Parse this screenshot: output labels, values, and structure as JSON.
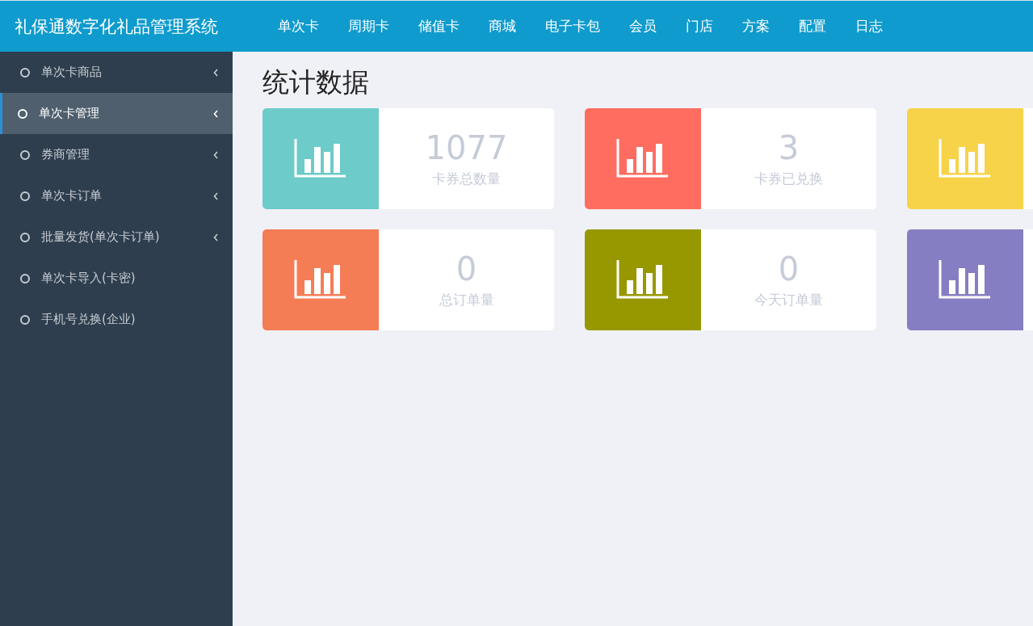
{
  "app_title": "礼保通数字化礼品管理系统",
  "nav": [
    {
      "label": "单次卡"
    },
    {
      "label": "周期卡"
    },
    {
      "label": "储值卡"
    },
    {
      "label": "商城"
    },
    {
      "label": "电子卡包"
    },
    {
      "label": "会员"
    },
    {
      "label": "门店"
    },
    {
      "label": "方案"
    },
    {
      "label": "配置"
    },
    {
      "label": "日志"
    }
  ],
  "sidebar": {
    "items": [
      {
        "label": "单次卡商品",
        "selected": false,
        "expandable": true
      },
      {
        "label": "单次卡管理",
        "selected": true,
        "expandable": true
      },
      {
        "label": "券商管理",
        "selected": false,
        "expandable": true
      },
      {
        "label": "单次卡订单",
        "selected": false,
        "expandable": true
      },
      {
        "label": "批量发货(单次卡订单)",
        "selected": false,
        "expandable": true
      },
      {
        "label": "单次卡导入(卡密)",
        "selected": false,
        "expandable": false
      },
      {
        "label": "手机号兑换(企业)",
        "selected": false,
        "expandable": false
      }
    ]
  },
  "page_title": "统计数据",
  "stats": [
    {
      "color": "#6dcbc9",
      "value": "1077",
      "label": "卡券总数量"
    },
    {
      "color": "#ff6d60",
      "value": "3",
      "label": "卡券已兑换"
    },
    {
      "color": "#f7d349"
    },
    {
      "color": "#f47d56",
      "value": "0",
      "label": "总订单量"
    },
    {
      "color": "#979800",
      "value": "0",
      "label": "今天订单量"
    },
    {
      "color": "#867ec3"
    }
  ]
}
